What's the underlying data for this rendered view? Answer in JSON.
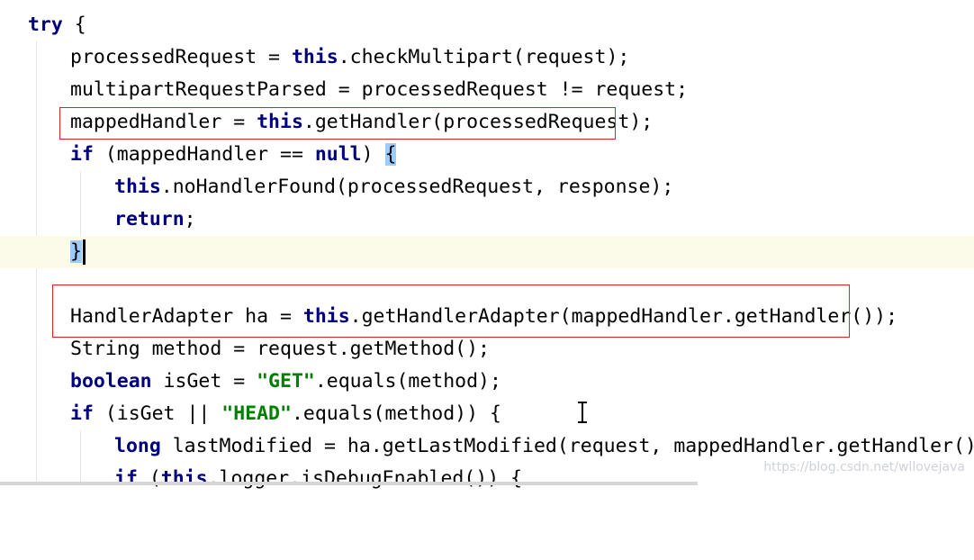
{
  "editor": {
    "lines": [
      {
        "id": "try",
        "tokens": [
          {
            "t": "try",
            "c": "kw"
          },
          {
            "t": " {",
            "c": "op"
          }
        ]
      },
      {
        "id": "processed-request",
        "tokens": [
          {
            "t": "processedRequest = ",
            "c": "op"
          },
          {
            "t": "this",
            "c": "kw"
          },
          {
            "t": ".checkMultipart(request);",
            "c": "op"
          }
        ]
      },
      {
        "id": "multipart-parsed",
        "tokens": [
          {
            "t": "multipartRequestParsed = processedRequest != request;",
            "c": "op"
          }
        ]
      },
      {
        "id": "mapped-handler",
        "tokens": [
          {
            "t": "mappedHandler = ",
            "c": "op"
          },
          {
            "t": "this",
            "c": "kw"
          },
          {
            "t": ".getHandler(processedRequest);",
            "c": "op"
          }
        ]
      },
      {
        "id": "if-null",
        "tokens": [
          {
            "t": "if",
            "c": "kw"
          },
          {
            "t": " (mappedHandler == ",
            "c": "op"
          },
          {
            "t": "null",
            "c": "kw"
          },
          {
            "t": ") ",
            "c": "op"
          },
          {
            "t": "{",
            "c": "brace"
          }
        ]
      },
      {
        "id": "no-handler-found",
        "tokens": [
          {
            "t": "this",
            "c": "kw"
          },
          {
            "t": ".noHandlerFound(processedRequest, response);",
            "c": "op"
          }
        ]
      },
      {
        "id": "return",
        "tokens": [
          {
            "t": "return",
            "c": "kw"
          },
          {
            "t": ";",
            "c": "op"
          }
        ]
      },
      {
        "id": "close-brace",
        "tokens": [
          {
            "t": "}",
            "c": "brace"
          }
        ]
      },
      {
        "id": "blank",
        "tokens": []
      },
      {
        "id": "handler-adapter",
        "tokens": [
          {
            "t": "HandlerAdapter ha = ",
            "c": "op"
          },
          {
            "t": "this",
            "c": "kw"
          },
          {
            "t": ".getHandlerAdapter(mappedHandler.getHandler());",
            "c": "op"
          }
        ]
      },
      {
        "id": "string-method",
        "tokens": [
          {
            "t": "String method = request.getMethod();",
            "c": "op"
          }
        ]
      },
      {
        "id": "boolean-isget",
        "tokens": [
          {
            "t": "boolean",
            "c": "kw"
          },
          {
            "t": " isGet = ",
            "c": "op"
          },
          {
            "t": "\"GET\"",
            "c": "str"
          },
          {
            "t": ".equals(method);",
            "c": "op"
          }
        ]
      },
      {
        "id": "if-isget",
        "tokens": [
          {
            "t": "if",
            "c": "kw"
          },
          {
            "t": " (isGet || ",
            "c": "op"
          },
          {
            "t": "\"HEAD\"",
            "c": "str"
          },
          {
            "t": ".equals(method)) {",
            "c": "op"
          }
        ]
      },
      {
        "id": "long-last-modified",
        "tokens": [
          {
            "t": "long",
            "c": "kw"
          },
          {
            "t": " lastModified = ha.getLastModified(request, mappedHandler.getHandler());",
            "c": "op"
          }
        ]
      },
      {
        "id": "if-debug",
        "tokens": [
          {
            "t": "if",
            "c": "kw"
          },
          {
            "t": " (",
            "c": "op"
          },
          {
            "t": "this",
            "c": "kw"
          },
          {
            "t": ".logger.isDebugEnabled()) {",
            "c": "op"
          }
        ]
      }
    ]
  },
  "colors": {
    "keyword": "#000080",
    "string": "#008000",
    "highlight_box": "#e0202a",
    "current_line": "#fcfae8",
    "brace_match": "#99ccff"
  },
  "watermark": "https://blog.csdn.net/wllovejava"
}
